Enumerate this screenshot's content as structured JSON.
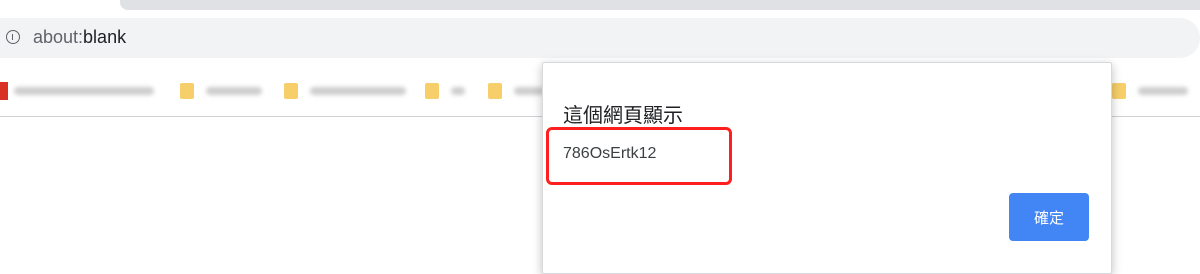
{
  "address_bar": {
    "url_scheme": "about:",
    "url_path": "blank"
  },
  "dialog": {
    "title": "這個網頁顯示",
    "message": "786OsErtk12",
    "ok_button": "確定"
  },
  "colors": {
    "accent": "#4285f4",
    "highlight": "#ff1f1f"
  }
}
